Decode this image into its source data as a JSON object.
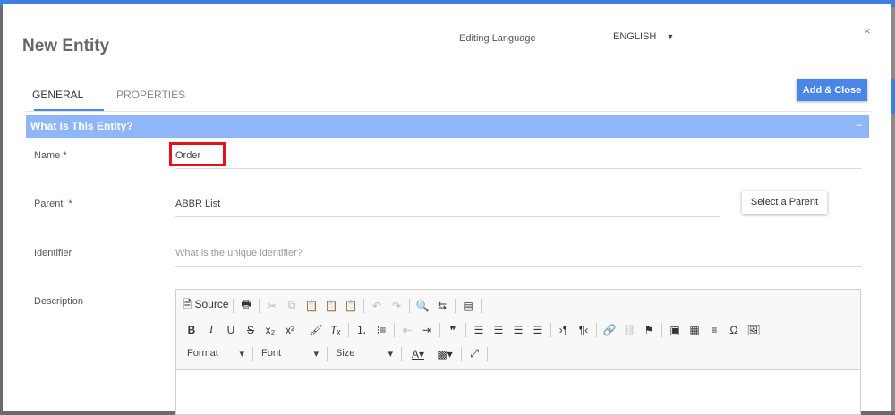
{
  "modal": {
    "title": "New Entity",
    "editing_language_label": "Editing Language",
    "language": "ENGLISH",
    "close": "×"
  },
  "tabs": [
    {
      "label": "GENERAL"
    },
    {
      "label": "PROPERTIES"
    }
  ],
  "add_close": "Add & Close",
  "section": {
    "title": "What Is This Entity?",
    "collapse": "–"
  },
  "fields": {
    "name": {
      "label": "Name *",
      "value": "Order"
    },
    "parent": {
      "label": "Parent  *",
      "value": "ABBR List",
      "button": "Select a Parent"
    },
    "identifier": {
      "label": "Identifier",
      "placeholder": "What is the unique identifier?"
    },
    "description": {
      "label": "Description"
    }
  },
  "editor": {
    "source": "Source",
    "format": "Format",
    "font": "Font",
    "size": "Size"
  }
}
